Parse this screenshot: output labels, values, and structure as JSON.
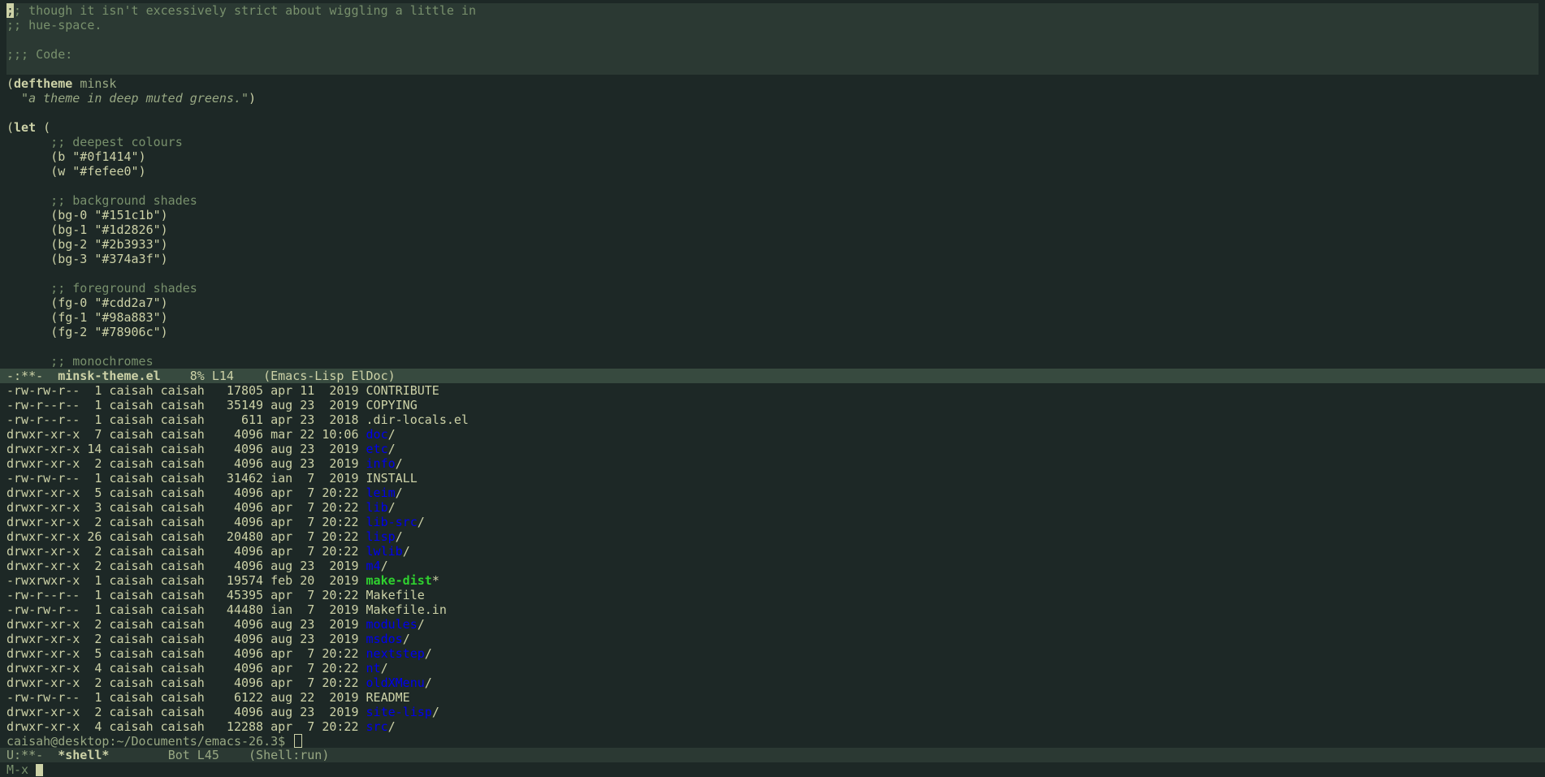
{
  "editor": {
    "lines": [
      {
        "type": "comment-first",
        "cursor": ";",
        "rest": "; though it isn't excessively strict about wiggling a little in"
      },
      {
        "type": "comment",
        "text": ";; hue-space."
      },
      {
        "type": "blank",
        "text": ""
      },
      {
        "type": "comment",
        "text": ";;; Code:"
      },
      {
        "type": "blank",
        "text": ""
      },
      {
        "type": "deftheme",
        "open": "(",
        "kw": "deftheme",
        "name": "minsk"
      },
      {
        "type": "docstring",
        "text": "  \"a theme in deep muted greens.\"",
        "close": ")"
      },
      {
        "type": "blank",
        "text": ""
      },
      {
        "type": "let",
        "open": "(",
        "kw": "let",
        "rest": " ("
      },
      {
        "type": "comment",
        "text": "      ;; deepest colours"
      },
      {
        "type": "binding",
        "indent": "      ",
        "name": "b",
        "value": "\"#0f1414\""
      },
      {
        "type": "binding",
        "indent": "      ",
        "name": "w",
        "value": "\"#fefee0\""
      },
      {
        "type": "blank",
        "text": ""
      },
      {
        "type": "comment",
        "text": "      ;; background shades"
      },
      {
        "type": "binding",
        "indent": "      ",
        "name": "bg-0",
        "value": "\"#151c1b\""
      },
      {
        "type": "binding",
        "indent": "      ",
        "name": "bg-1",
        "value": "\"#1d2826\""
      },
      {
        "type": "binding",
        "indent": "      ",
        "name": "bg-2",
        "value": "\"#2b3933\""
      },
      {
        "type": "binding",
        "indent": "      ",
        "name": "bg-3",
        "value": "\"#374a3f\""
      },
      {
        "type": "blank",
        "text": ""
      },
      {
        "type": "comment",
        "text": "      ;; foreground shades"
      },
      {
        "type": "binding",
        "indent": "      ",
        "name": "fg-0",
        "value": "\"#cdd2a7\""
      },
      {
        "type": "binding",
        "indent": "      ",
        "name": "fg-1",
        "value": "\"#98a883\""
      },
      {
        "type": "binding",
        "indent": "      ",
        "name": "fg-2",
        "value": "\"#78906c\""
      },
      {
        "type": "blank",
        "text": ""
      },
      {
        "type": "comment",
        "text": "      ;; monochromes"
      }
    ]
  },
  "modeline_top": {
    "status": "-:**-",
    "buffer": "minsk-theme.el",
    "position": "8% L14",
    "mode": "(Emacs-Lisp ElDoc)"
  },
  "shell": {
    "listing": [
      {
        "perm": "-rw-rw-r--",
        "links": " 1",
        "user": "caisah",
        "group": "caisah",
        "size": "17805",
        "date": "apr 11  2019",
        "name": "CONTRIBUTE",
        "kind": "file"
      },
      {
        "perm": "-rw-r--r--",
        "links": " 1",
        "user": "caisah",
        "group": "caisah",
        "size": "35149",
        "date": "aug 23  2019",
        "name": "COPYING",
        "kind": "file"
      },
      {
        "perm": "-rw-r--r--",
        "links": " 1",
        "user": "caisah",
        "group": "caisah",
        "size": "611",
        "date": "apr 23  2018",
        "name": ".dir-locals.el",
        "kind": "file"
      },
      {
        "perm": "drwxr-xr-x",
        "links": " 7",
        "user": "caisah",
        "group": "caisah",
        "size": "4096",
        "date": "mar 22 10:06",
        "name": "doc",
        "kind": "dir"
      },
      {
        "perm": "drwxr-xr-x",
        "links": "14",
        "user": "caisah",
        "group": "caisah",
        "size": "4096",
        "date": "aug 23  2019",
        "name": "etc",
        "kind": "dir"
      },
      {
        "perm": "drwxr-xr-x",
        "links": " 2",
        "user": "caisah",
        "group": "caisah",
        "size": "4096",
        "date": "aug 23  2019",
        "name": "info",
        "kind": "dir"
      },
      {
        "perm": "-rw-rw-r--",
        "links": " 1",
        "user": "caisah",
        "group": "caisah",
        "size": "31462",
        "date": "ian  7  2019",
        "name": "INSTALL",
        "kind": "file"
      },
      {
        "perm": "drwxr-xr-x",
        "links": " 5",
        "user": "caisah",
        "group": "caisah",
        "size": "4096",
        "date": "apr  7 20:22",
        "name": "leim",
        "kind": "dir"
      },
      {
        "perm": "drwxr-xr-x",
        "links": " 3",
        "user": "caisah",
        "group": "caisah",
        "size": "4096",
        "date": "apr  7 20:22",
        "name": "lib",
        "kind": "dir"
      },
      {
        "perm": "drwxr-xr-x",
        "links": " 2",
        "user": "caisah",
        "group": "caisah",
        "size": "4096",
        "date": "apr  7 20:22",
        "name": "lib-src",
        "kind": "dir"
      },
      {
        "perm": "drwxr-xr-x",
        "links": "26",
        "user": "caisah",
        "group": "caisah",
        "size": "20480",
        "date": "apr  7 20:22",
        "name": "lisp",
        "kind": "dir"
      },
      {
        "perm": "drwxr-xr-x",
        "links": " 2",
        "user": "caisah",
        "group": "caisah",
        "size": "4096",
        "date": "apr  7 20:22",
        "name": "lwlib",
        "kind": "dir"
      },
      {
        "perm": "drwxr-xr-x",
        "links": " 2",
        "user": "caisah",
        "group": "caisah",
        "size": "4096",
        "date": "aug 23  2019",
        "name": "m4",
        "kind": "dir"
      },
      {
        "perm": "-rwxrwxr-x",
        "links": " 1",
        "user": "caisah",
        "group": "caisah",
        "size": "19574",
        "date": "feb 20  2019",
        "name": "make-dist",
        "kind": "exe"
      },
      {
        "perm": "-rw-r--r--",
        "links": " 1",
        "user": "caisah",
        "group": "caisah",
        "size": "45395",
        "date": "apr  7 20:22",
        "name": "Makefile",
        "kind": "file"
      },
      {
        "perm": "-rw-rw-r--",
        "links": " 1",
        "user": "caisah",
        "group": "caisah",
        "size": "44480",
        "date": "ian  7  2019",
        "name": "Makefile.in",
        "kind": "file"
      },
      {
        "perm": "drwxr-xr-x",
        "links": " 2",
        "user": "caisah",
        "group": "caisah",
        "size": "4096",
        "date": "aug 23  2019",
        "name": "modules",
        "kind": "dir"
      },
      {
        "perm": "drwxr-xr-x",
        "links": " 2",
        "user": "caisah",
        "group": "caisah",
        "size": "4096",
        "date": "aug 23  2019",
        "name": "msdos",
        "kind": "dir"
      },
      {
        "perm": "drwxr-xr-x",
        "links": " 5",
        "user": "caisah",
        "group": "caisah",
        "size": "4096",
        "date": "apr  7 20:22",
        "name": "nextstep",
        "kind": "dir"
      },
      {
        "perm": "drwxr-xr-x",
        "links": " 4",
        "user": "caisah",
        "group": "caisah",
        "size": "4096",
        "date": "apr  7 20:22",
        "name": "nt",
        "kind": "dir"
      },
      {
        "perm": "drwxr-xr-x",
        "links": " 2",
        "user": "caisah",
        "group": "caisah",
        "size": "4096",
        "date": "apr  7 20:22",
        "name": "oldXMenu",
        "kind": "dir"
      },
      {
        "perm": "-rw-rw-r--",
        "links": " 1",
        "user": "caisah",
        "group": "caisah",
        "size": "6122",
        "date": "aug 22  2019",
        "name": "README",
        "kind": "file"
      },
      {
        "perm": "drwxr-xr-x",
        "links": " 2",
        "user": "caisah",
        "group": "caisah",
        "size": "4096",
        "date": "aug 23  2019",
        "name": "site-lisp",
        "kind": "dir"
      },
      {
        "perm": "drwxr-xr-x",
        "links": " 4",
        "user": "caisah",
        "group": "caisah",
        "size": "12288",
        "date": "apr  7 20:22",
        "name": "src",
        "kind": "dir"
      }
    ],
    "prompt": "caisah@desktop:~/Documents/emacs-26.3$"
  },
  "modeline_bottom": {
    "status": "U:**-",
    "buffer": "*shell*",
    "position": "Bot L45",
    "mode": "(Shell:run)"
  },
  "minibuffer": {
    "text": "M-x "
  },
  "colors": {
    "bg": "#1d2826",
    "bg_dark": "#151c1b",
    "bg_highlight": "#2b3933",
    "modeline": "#374a3f",
    "fg": "#cdd2a7",
    "fg_muted": "#98a883",
    "comment": "#78906c",
    "dir": "#0000ee",
    "exe": "#2fd12f"
  }
}
